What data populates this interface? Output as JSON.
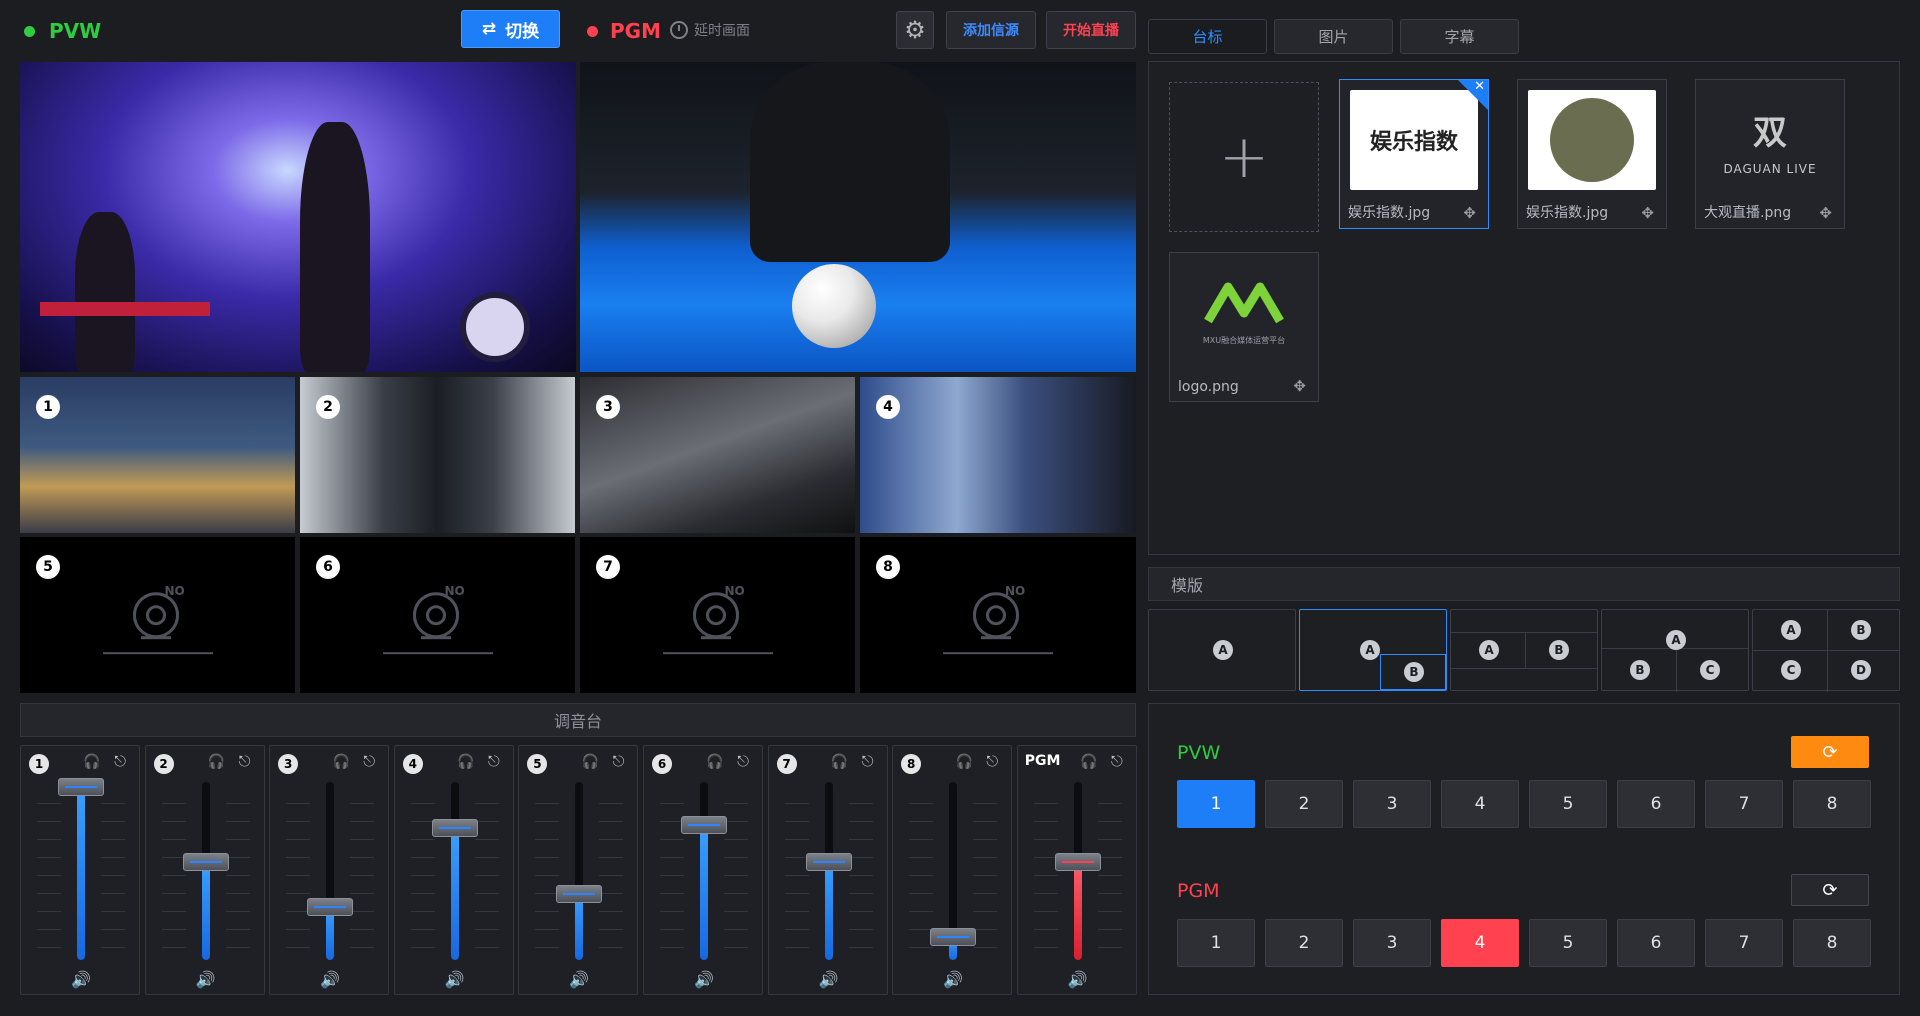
{
  "header": {
    "pvw_label": "PVW",
    "switch_label": "切换",
    "pgm_label": "PGM",
    "delay_label": "延时画面",
    "add_source_label": "添加信源",
    "go_live_label": "开始直播"
  },
  "sources": [
    {
      "num": "1",
      "state": "image"
    },
    {
      "num": "2",
      "state": "image"
    },
    {
      "num": "3",
      "state": "image"
    },
    {
      "num": "4",
      "state": "image"
    },
    {
      "num": "5",
      "state": "no-signal",
      "no_text": "NO"
    },
    {
      "num": "6",
      "state": "no-signal",
      "no_text": "NO"
    },
    {
      "num": "7",
      "state": "no-signal",
      "no_text": "NO"
    },
    {
      "num": "8",
      "state": "no-signal",
      "no_text": "NO"
    }
  ],
  "mixer": {
    "title": "调音台",
    "channels": [
      {
        "label": "1",
        "level": 0.97
      },
      {
        "label": "2",
        "level": 0.55
      },
      {
        "label": "3",
        "level": 0.3
      },
      {
        "label": "4",
        "level": 0.74
      },
      {
        "label": "5",
        "level": 0.37
      },
      {
        "label": "6",
        "level": 0.76
      },
      {
        "label": "7",
        "level": 0.55
      },
      {
        "label": "8",
        "level": 0.13
      },
      {
        "label": "PGM",
        "level": 0.55
      }
    ]
  },
  "tabs": [
    "台标",
    "图片",
    "字幕"
  ],
  "active_tab": "台标",
  "logos": {
    "items": [
      {
        "name": "娱乐指数.jpg",
        "art_text": "娱乐指数",
        "selected": true
      },
      {
        "name": "娱乐指数.jpg",
        "art_text": "",
        "selected": false
      },
      {
        "name": "大观直播.png",
        "art_text": "DAGUAN LIVE",
        "selected": false
      },
      {
        "name": "logo.png",
        "art_text": "MXU融合媒体运营平台",
        "selected": false
      }
    ]
  },
  "templates": {
    "title": "模版",
    "badges": [
      "A",
      "B",
      "C",
      "D"
    ]
  },
  "switcher": {
    "pvw_label": "PVW",
    "pgm_label": "PGM",
    "buttons": [
      "1",
      "2",
      "3",
      "4",
      "5",
      "6",
      "7",
      "8"
    ],
    "pvw_active": "1",
    "pgm_active": "4"
  },
  "colors": {
    "accent_blue": "#1e7ef7",
    "pvw_green": "#2ecc40",
    "pgm_red": "#ff4150",
    "refresh_orange": "#ff8a10"
  }
}
